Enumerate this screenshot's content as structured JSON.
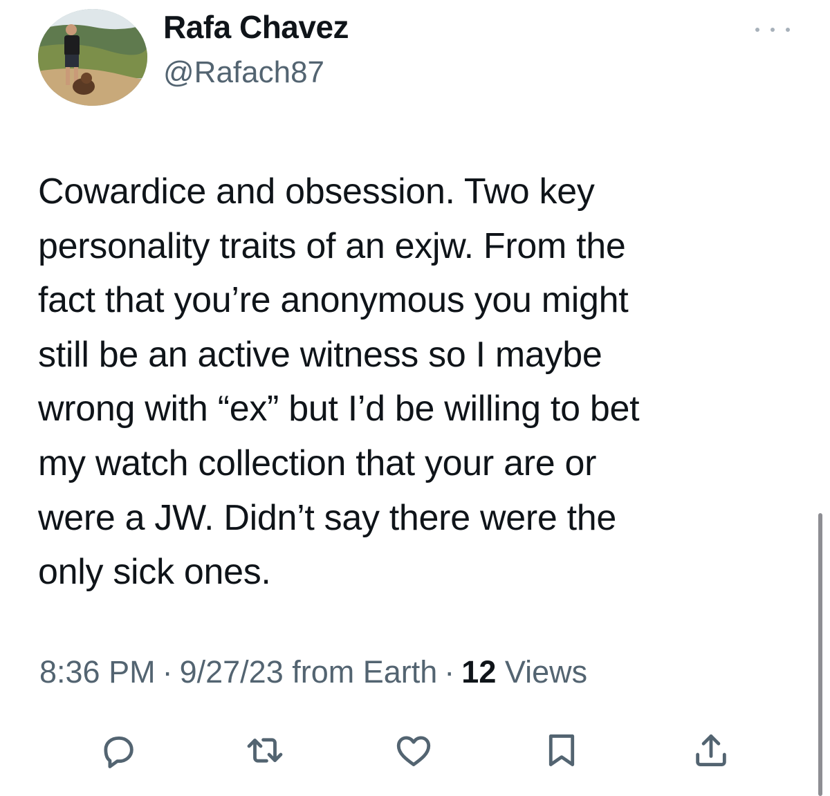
{
  "author": {
    "display_name": "Rafa Chavez",
    "handle": "@Rafach87",
    "avatar_icon": "profile-photo-avatar"
  },
  "tweet": {
    "lines": [
      "Cowardice and obsession. Two key",
      "personality traits of an exjw. From the",
      "fact that you’re anonymous you might",
      "still be an active witness so I maybe",
      "wrong with “ex” but I’d be willing to bet",
      "my watch collection that your are or",
      "were a JW. Didn’t say there were the",
      "only sick ones."
    ]
  },
  "meta": {
    "time": "8:36 PM",
    "separator": "·",
    "date": "9/27/23 from Earth",
    "views_count": "12",
    "views_label": "Views"
  },
  "actions": [
    {
      "icon": "reply-icon"
    },
    {
      "icon": "retweet-icon"
    },
    {
      "icon": "like-icon"
    },
    {
      "icon": "bookmark-icon"
    },
    {
      "icon": "share-icon"
    }
  ],
  "colors": {
    "text_primary": "#0f1419",
    "text_secondary": "#536471",
    "background": "#ffffff"
  }
}
